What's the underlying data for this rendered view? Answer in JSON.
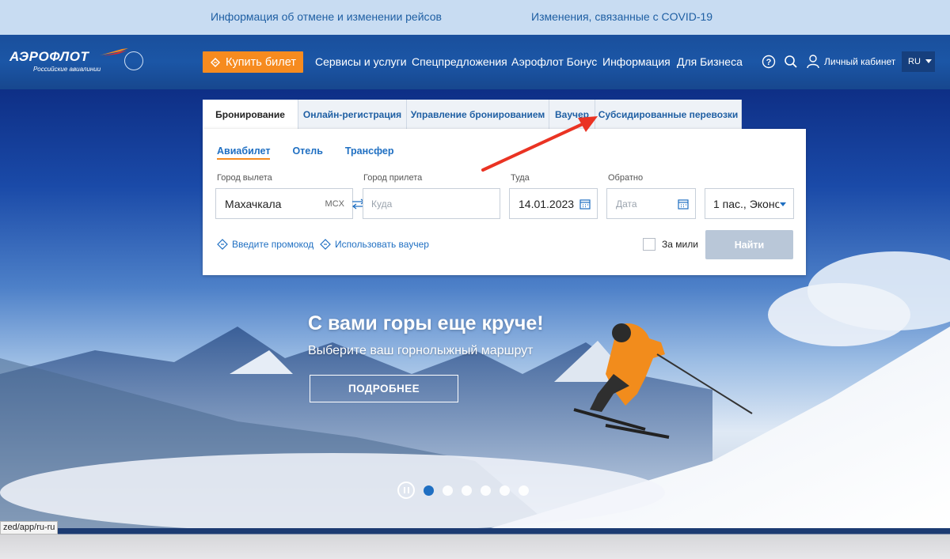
{
  "info_bar": {
    "link1": "Информация об отмене и изменении рейсов",
    "link2": "Изменения, связанные с COVID-19"
  },
  "header": {
    "logo_text": "АЭРОФЛОТ",
    "logo_subtitle": "Российские авиалинии",
    "buy_button": "Купить билет",
    "nav": [
      "Сервисы и услуги",
      "Спецпредложения",
      "Аэрофлот Бонус",
      "Информация",
      "Для Бизнеса"
    ],
    "cabinet": "Личный кабинет",
    "lang": "RU"
  },
  "booking": {
    "tabs": [
      "Бронирование",
      "Онлайн-регистрация",
      "Управление бронированием",
      "Ваучер",
      "Субсидированные перевозки"
    ],
    "active_tab": "Бронирование",
    "subtabs": [
      "Авиабилет",
      "Отель",
      "Трансфер"
    ],
    "from_label": "Город вылета",
    "from_value": "Махачкала",
    "from_code": "MCX",
    "to_label": "Город прилета",
    "to_placeholder": "Куда",
    "depart_label": "Туда",
    "depart_value": "14.01.2023",
    "return_label": "Обратно",
    "return_placeholder": "Дата",
    "passengers": "1 пас., Эконо",
    "promo_link": "Введите промокод",
    "voucher_link": "Использовать ваучер",
    "miles_label": "За мили",
    "find_button": "Найти"
  },
  "hero": {
    "title": "С вами горы еще круче!",
    "subtitle": "Выберите ваш горнолыжный маршрут",
    "more_button": "ПОДРОБНЕЕ",
    "slides_total": 6,
    "active_slide": 1
  },
  "status_url": "zed/app/ru-ru",
  "colors": {
    "brand_blue": "#1b56a6",
    "accent_orange": "#f68b1f",
    "link_blue": "#1f6fc2",
    "annotation_red": "#ea3323"
  }
}
